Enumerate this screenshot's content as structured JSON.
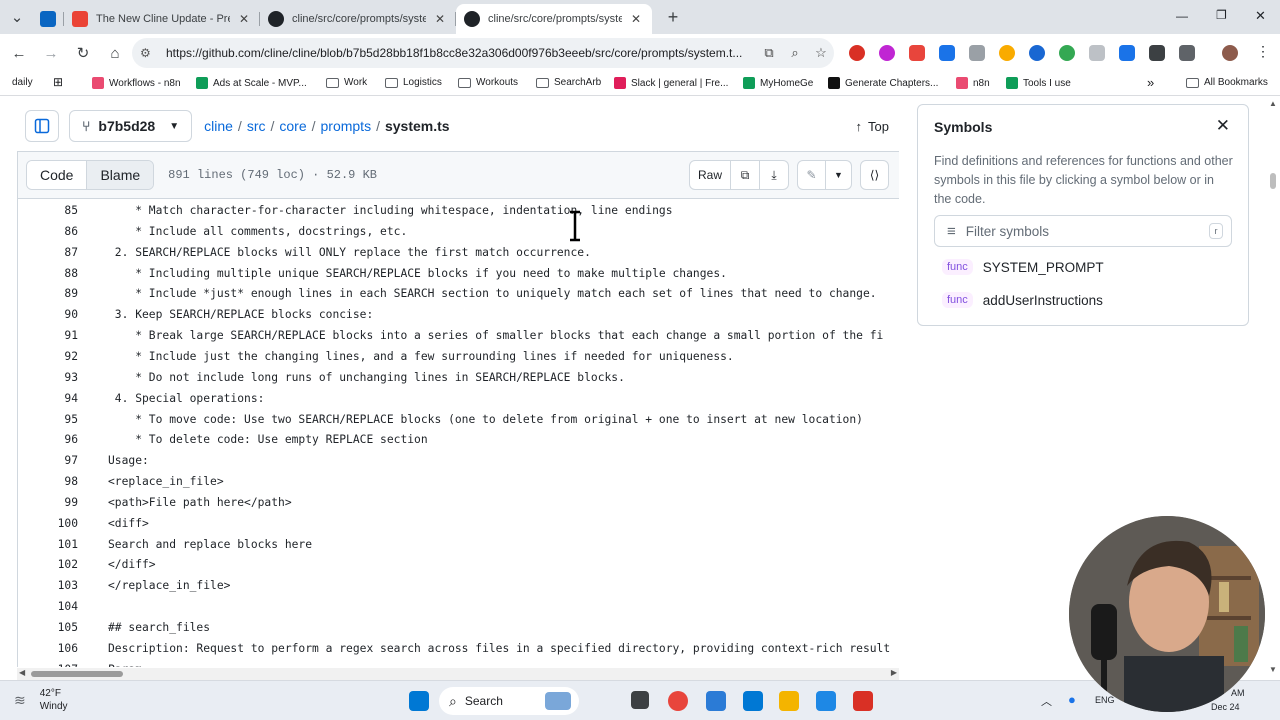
{
  "browser": {
    "tabs": [
      {
        "title": "",
        "favicon_color": "#0a66c2"
      },
      {
        "title": "The New Cline Update - Presen",
        "favicon_color": "#ea4335"
      },
      {
        "title": "cline/src/core/prompts/system",
        "favicon_color": "#1f2328"
      },
      {
        "title": "cline/src/core/prompts/system",
        "favicon_color": "#1f2328"
      }
    ],
    "new_tab": "+",
    "url": "https://github.com/cline/cline/blob/b7b5d28bb18f1b8cc8e32a306d00f976b3eeeb/src/core/prompts/system.t...",
    "bookmarks": [
      "daily",
      "Workflows - n8n",
      "Ads at Scale - MVP...",
      "Work",
      "Logistics",
      "Workouts",
      "SearchArb",
      "Slack | general | Fre...",
      "MyHomeGe",
      "Generate Chapters...",
      "n8n",
      "Tools I use"
    ],
    "all_bookmarks": "All Bookmarks",
    "more_bookmarks": "»"
  },
  "github": {
    "branch": "b7b5d28",
    "breadcrumb": [
      "cline",
      "src",
      "core",
      "prompts"
    ],
    "filename": "system.ts",
    "top_label": "Top",
    "code_tab": "Code",
    "blame_tab": "Blame",
    "file_meta": "891 lines (749 loc) · 52.9 KB",
    "raw_label": "Raw",
    "lines": [
      {
        "n": "85",
        "t": "    * Match character-for-character including whitespace, indentation, line endings"
      },
      {
        "n": "86",
        "t": "    * Include all comments, docstrings, etc."
      },
      {
        "n": "87",
        "t": " 2. SEARCH/REPLACE blocks will ONLY replace the first match occurrence."
      },
      {
        "n": "88",
        "t": "    * Including multiple unique SEARCH/REPLACE blocks if you need to make multiple changes."
      },
      {
        "n": "89",
        "t": "    * Include *just* enough lines in each SEARCH section to uniquely match each set of lines that need to change."
      },
      {
        "n": "90",
        "t": " 3. Keep SEARCH/REPLACE blocks concise:"
      },
      {
        "n": "91",
        "t": "    * Break large SEARCH/REPLACE blocks into a series of smaller blocks that each change a small portion of the fi"
      },
      {
        "n": "92",
        "t": "    * Include just the changing lines, and a few surrounding lines if needed for uniqueness."
      },
      {
        "n": "93",
        "t": "    * Do not include long runs of unchanging lines in SEARCH/REPLACE blocks."
      },
      {
        "n": "94",
        "t": " 4. Special operations:"
      },
      {
        "n": "95",
        "t": "    * To move code: Use two SEARCH/REPLACE blocks (one to delete from original + one to insert at new location)"
      },
      {
        "n": "96",
        "t": "    * To delete code: Use empty REPLACE section"
      },
      {
        "n": "97",
        "t": "Usage:"
      },
      {
        "n": "98",
        "t": "<replace_in_file>"
      },
      {
        "n": "99",
        "t": "<path>File path here</path>"
      },
      {
        "n": "100",
        "t": "<diff>"
      },
      {
        "n": "101",
        "t": "Search and replace blocks here"
      },
      {
        "n": "102",
        "t": "</diff>"
      },
      {
        "n": "103",
        "t": "</replace_in_file>"
      },
      {
        "n": "104",
        "t": ""
      },
      {
        "n": "105",
        "t": "## search_files"
      },
      {
        "n": "106",
        "t": "Description: Request to perform a regex search across files in a specified directory, providing context-rich result"
      },
      {
        "n": "107",
        "t": "Param"
      }
    ]
  },
  "symbols": {
    "title": "Symbols",
    "description": "Find definitions and references for functions and other symbols in this file by clicking a symbol below or in the code.",
    "filter_placeholder": "Filter symbols",
    "kbd": "r",
    "items": [
      {
        "kind": "func",
        "name": "SYSTEM_PROMPT"
      },
      {
        "kind": "func",
        "name": "addUserInstructions"
      }
    ]
  },
  "taskbar": {
    "temperature": "42°F",
    "condition": "Windy",
    "search": "Search",
    "lang": "ENG",
    "time": "AM",
    "date": "Dec 24"
  }
}
